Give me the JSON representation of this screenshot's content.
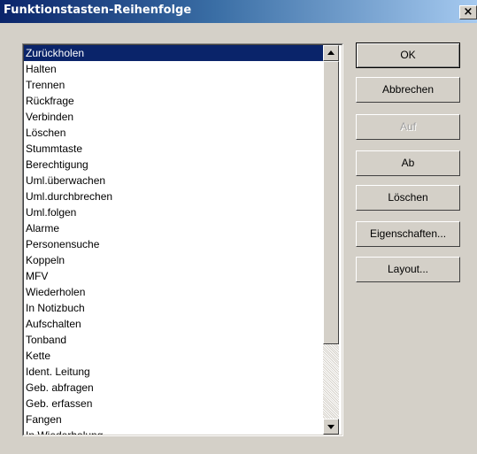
{
  "window": {
    "title": "Funktionstasten-Reihenfolge",
    "close_glyph": "×"
  },
  "list": {
    "selected_index": 0,
    "items": [
      "Zurückholen",
      "Halten",
      "Trennen",
      "Rückfrage",
      "Verbinden",
      "Löschen",
      "Stummtaste",
      "Berechtigung",
      "Uml.überwachen",
      "Uml.durchbrechen",
      "Uml.folgen",
      "Alarme",
      "Personensuche",
      "Koppeln",
      "MFV",
      "Wiederholen",
      "In Notizbuch",
      "Aufschalten",
      "Tonband",
      "Kette",
      "Ident. Leitung",
      "Geb. abfragen",
      "Geb. erfassen",
      "Fangen",
      "In Wiederholung"
    ]
  },
  "buttons": {
    "ok": "OK",
    "cancel": "Abbrechen",
    "up": "Auf",
    "down": "Ab",
    "delete": "Löschen",
    "properties": "Eigenschaften...",
    "layout": "Layout..."
  },
  "states": {
    "up_disabled": true
  },
  "colors": {
    "selection": "#0a246a",
    "face": "#d4d0c8"
  }
}
